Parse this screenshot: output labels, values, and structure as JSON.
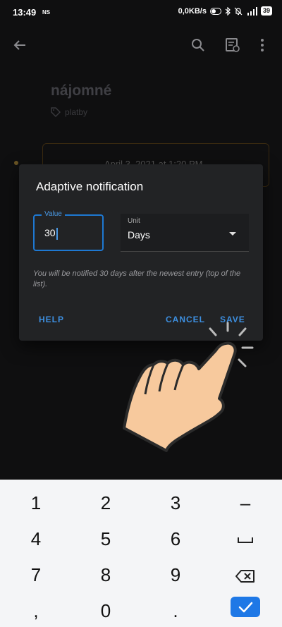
{
  "status_bar": {
    "time": "13:49",
    "ns": "NS",
    "speed": "0,0KB/s",
    "battery": "39"
  },
  "toolbar": {
    "back": "back-arrow-icon",
    "search": "search-icon",
    "notes": "notes-icon",
    "more": "more-vert-icon"
  },
  "background": {
    "title": "nájomné",
    "tag": "platby",
    "entry_date": "April 3, 2021 at 1:20 PM"
  },
  "dialog": {
    "title": "Adaptive notification",
    "value_label": "Value",
    "value": "30",
    "unit_label": "Unit",
    "unit_value": "Days",
    "hint": "You will be notified 30 days after the newest entry (top of the list).",
    "help_label": "HELP",
    "cancel_label": "CANCEL",
    "save_label": "SAVE"
  },
  "keyboard": {
    "rows": [
      [
        "1",
        "2",
        "3",
        "–"
      ],
      [
        "4",
        "5",
        "6",
        "␣"
      ],
      [
        "7",
        "8",
        "9",
        "⌫"
      ],
      [
        ",",
        "0",
        ".",
        "✓"
      ]
    ]
  },
  "colors": {
    "accent": "#1e78d2",
    "dialog_bg": "#222325",
    "keyboard_bg": "#f4f5f7"
  }
}
